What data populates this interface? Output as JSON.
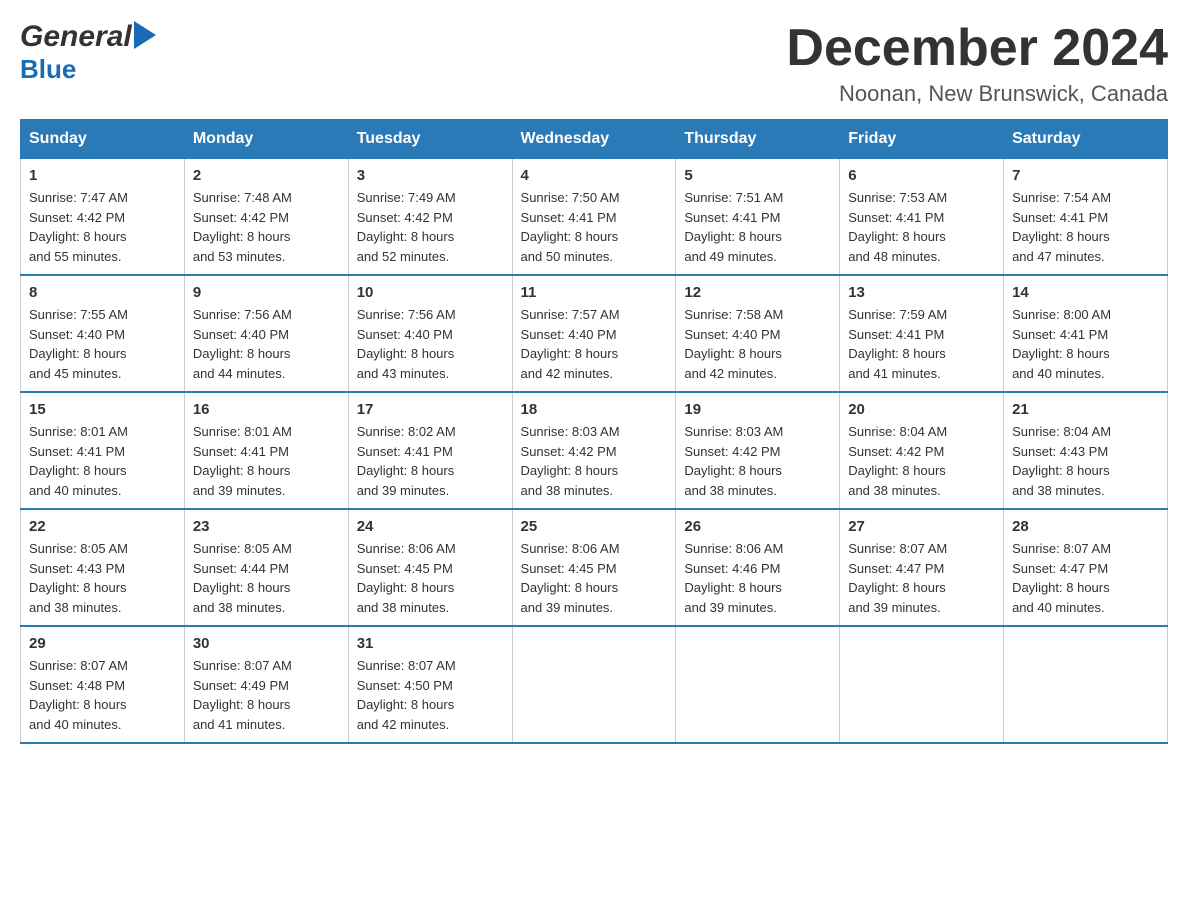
{
  "header": {
    "logo_general": "General",
    "logo_blue": "Blue",
    "month_title": "December 2024",
    "location": "Noonan, New Brunswick, Canada"
  },
  "days_of_week": [
    "Sunday",
    "Monday",
    "Tuesday",
    "Wednesday",
    "Thursday",
    "Friday",
    "Saturday"
  ],
  "weeks": [
    [
      {
        "num": "1",
        "sunrise": "7:47 AM",
        "sunset": "4:42 PM",
        "daylight": "8 hours and 55 minutes."
      },
      {
        "num": "2",
        "sunrise": "7:48 AM",
        "sunset": "4:42 PM",
        "daylight": "8 hours and 53 minutes."
      },
      {
        "num": "3",
        "sunrise": "7:49 AM",
        "sunset": "4:42 PM",
        "daylight": "8 hours and 52 minutes."
      },
      {
        "num": "4",
        "sunrise": "7:50 AM",
        "sunset": "4:41 PM",
        "daylight": "8 hours and 50 minutes."
      },
      {
        "num": "5",
        "sunrise": "7:51 AM",
        "sunset": "4:41 PM",
        "daylight": "8 hours and 49 minutes."
      },
      {
        "num": "6",
        "sunrise": "7:53 AM",
        "sunset": "4:41 PM",
        "daylight": "8 hours and 48 minutes."
      },
      {
        "num": "7",
        "sunrise": "7:54 AM",
        "sunset": "4:41 PM",
        "daylight": "8 hours and 47 minutes."
      }
    ],
    [
      {
        "num": "8",
        "sunrise": "7:55 AM",
        "sunset": "4:40 PM",
        "daylight": "8 hours and 45 minutes."
      },
      {
        "num": "9",
        "sunrise": "7:56 AM",
        "sunset": "4:40 PM",
        "daylight": "8 hours and 44 minutes."
      },
      {
        "num": "10",
        "sunrise": "7:56 AM",
        "sunset": "4:40 PM",
        "daylight": "8 hours and 43 minutes."
      },
      {
        "num": "11",
        "sunrise": "7:57 AM",
        "sunset": "4:40 PM",
        "daylight": "8 hours and 42 minutes."
      },
      {
        "num": "12",
        "sunrise": "7:58 AM",
        "sunset": "4:40 PM",
        "daylight": "8 hours and 42 minutes."
      },
      {
        "num": "13",
        "sunrise": "7:59 AM",
        "sunset": "4:41 PM",
        "daylight": "8 hours and 41 minutes."
      },
      {
        "num": "14",
        "sunrise": "8:00 AM",
        "sunset": "4:41 PM",
        "daylight": "8 hours and 40 minutes."
      }
    ],
    [
      {
        "num": "15",
        "sunrise": "8:01 AM",
        "sunset": "4:41 PM",
        "daylight": "8 hours and 40 minutes."
      },
      {
        "num": "16",
        "sunrise": "8:01 AM",
        "sunset": "4:41 PM",
        "daylight": "8 hours and 39 minutes."
      },
      {
        "num": "17",
        "sunrise": "8:02 AM",
        "sunset": "4:41 PM",
        "daylight": "8 hours and 39 minutes."
      },
      {
        "num": "18",
        "sunrise": "8:03 AM",
        "sunset": "4:42 PM",
        "daylight": "8 hours and 38 minutes."
      },
      {
        "num": "19",
        "sunrise": "8:03 AM",
        "sunset": "4:42 PM",
        "daylight": "8 hours and 38 minutes."
      },
      {
        "num": "20",
        "sunrise": "8:04 AM",
        "sunset": "4:42 PM",
        "daylight": "8 hours and 38 minutes."
      },
      {
        "num": "21",
        "sunrise": "8:04 AM",
        "sunset": "4:43 PM",
        "daylight": "8 hours and 38 minutes."
      }
    ],
    [
      {
        "num": "22",
        "sunrise": "8:05 AM",
        "sunset": "4:43 PM",
        "daylight": "8 hours and 38 minutes."
      },
      {
        "num": "23",
        "sunrise": "8:05 AM",
        "sunset": "4:44 PM",
        "daylight": "8 hours and 38 minutes."
      },
      {
        "num": "24",
        "sunrise": "8:06 AM",
        "sunset": "4:45 PM",
        "daylight": "8 hours and 38 minutes."
      },
      {
        "num": "25",
        "sunrise": "8:06 AM",
        "sunset": "4:45 PM",
        "daylight": "8 hours and 39 minutes."
      },
      {
        "num": "26",
        "sunrise": "8:06 AM",
        "sunset": "4:46 PM",
        "daylight": "8 hours and 39 minutes."
      },
      {
        "num": "27",
        "sunrise": "8:07 AM",
        "sunset": "4:47 PM",
        "daylight": "8 hours and 39 minutes."
      },
      {
        "num": "28",
        "sunrise": "8:07 AM",
        "sunset": "4:47 PM",
        "daylight": "8 hours and 40 minutes."
      }
    ],
    [
      {
        "num": "29",
        "sunrise": "8:07 AM",
        "sunset": "4:48 PM",
        "daylight": "8 hours and 40 minutes."
      },
      {
        "num": "30",
        "sunrise": "8:07 AM",
        "sunset": "4:49 PM",
        "daylight": "8 hours and 41 minutes."
      },
      {
        "num": "31",
        "sunrise": "8:07 AM",
        "sunset": "4:50 PM",
        "daylight": "8 hours and 42 minutes."
      },
      null,
      null,
      null,
      null
    ]
  ],
  "labels": {
    "sunrise": "Sunrise:",
    "sunset": "Sunset:",
    "daylight": "Daylight:"
  }
}
